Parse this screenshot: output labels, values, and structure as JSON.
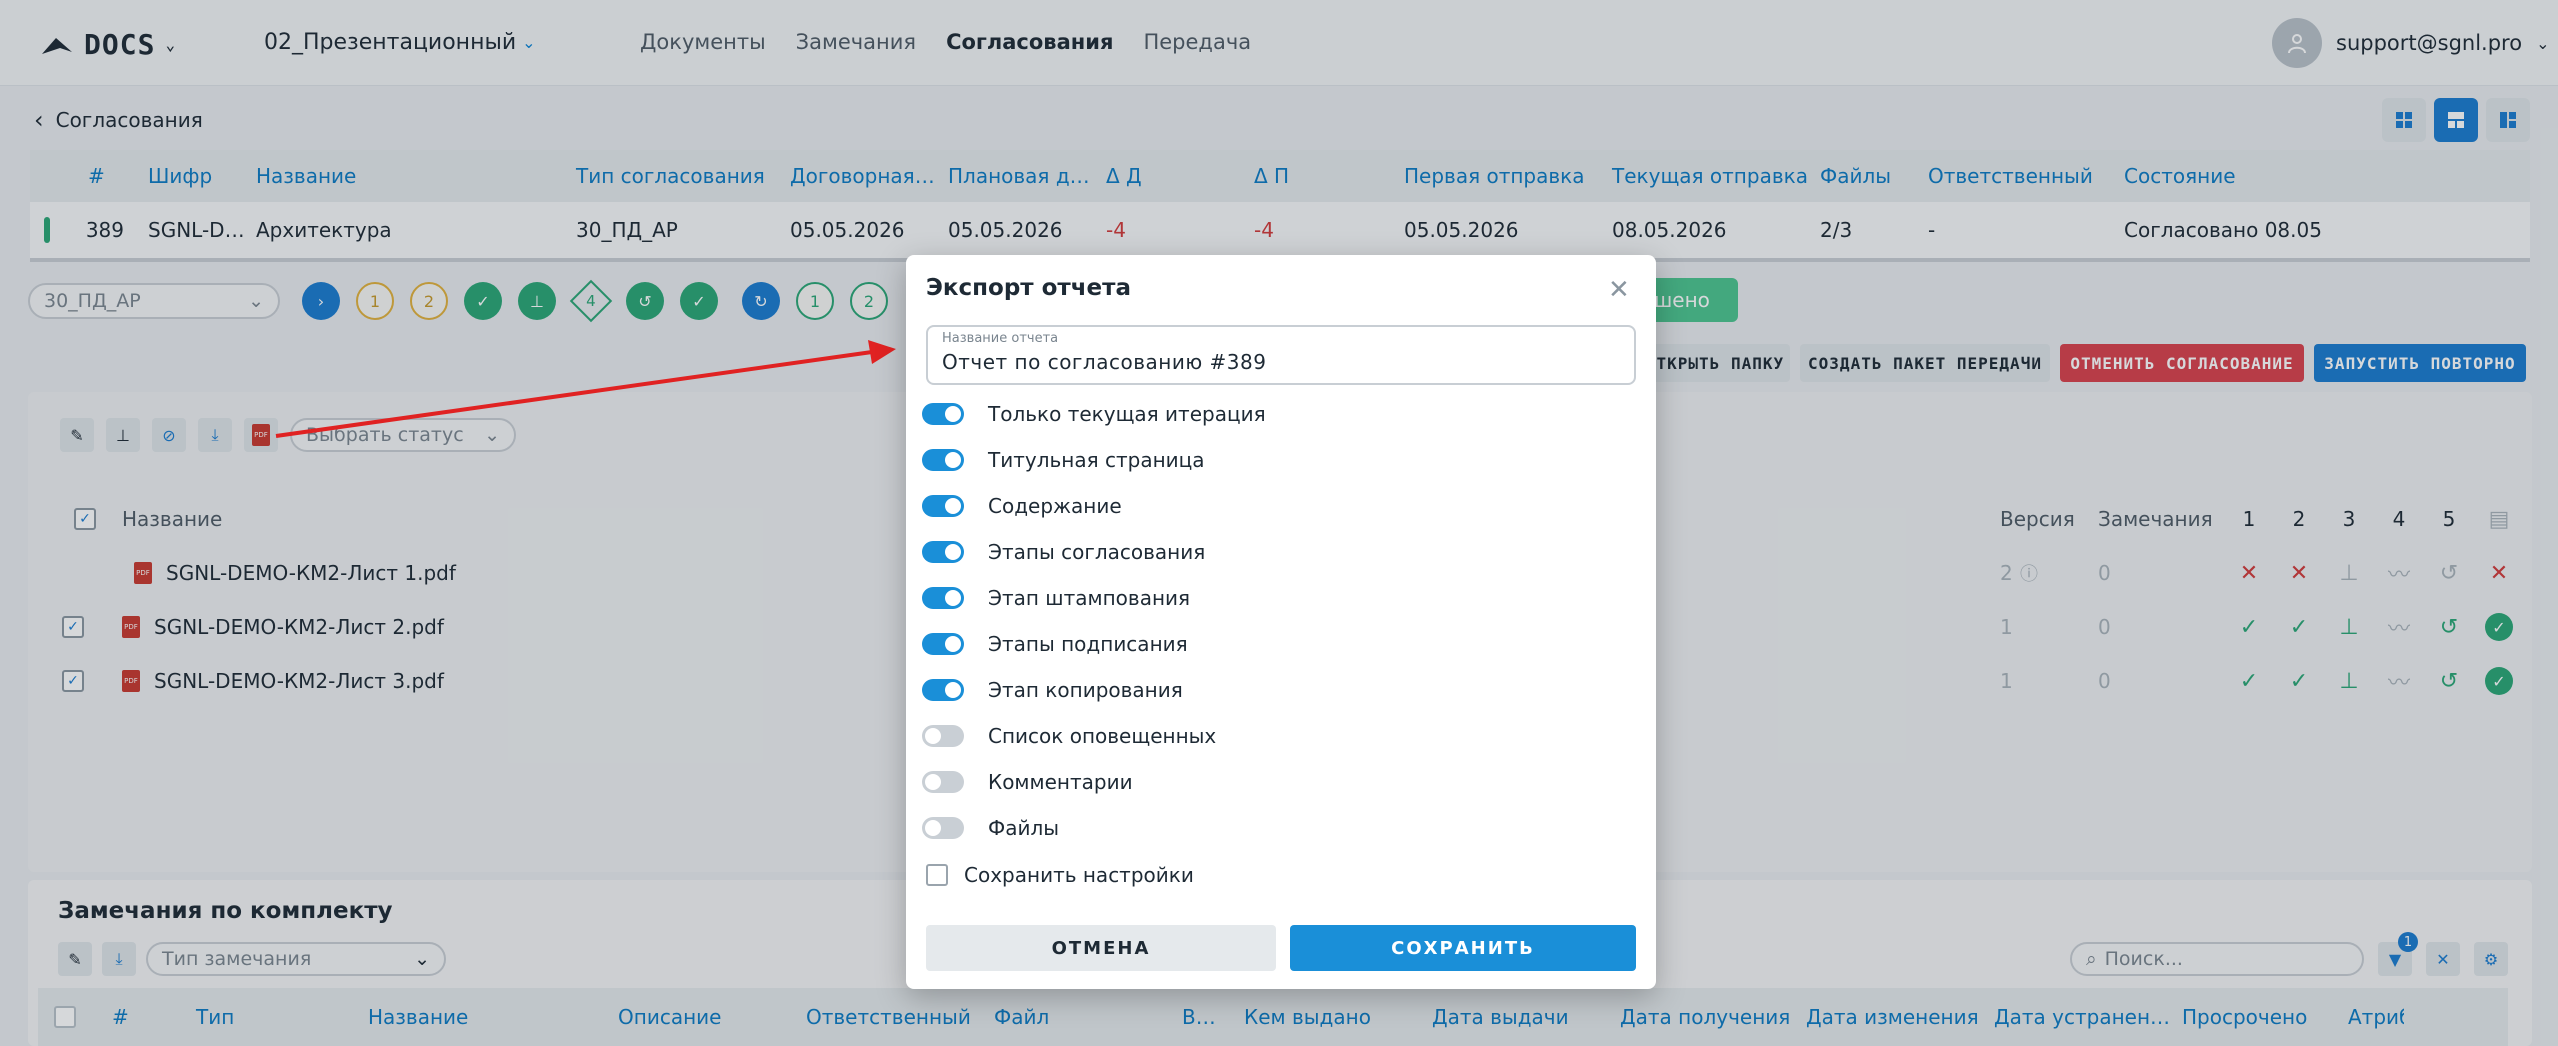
{
  "header": {
    "logo": "DOCS",
    "project": "02_Презентационный",
    "nav": [
      "Документы",
      "Замечания",
      "Согласования",
      "Передача"
    ],
    "user": "support@sgnl.pro"
  },
  "back": {
    "label": "Согласования"
  },
  "table": {
    "headers": [
      "#",
      "Шифр",
      "Название",
      "Тип согласования",
      "Договорная…",
      "Плановая д…",
      "Δ Д",
      "Δ П",
      "Первая отправка",
      "Текущая отправка",
      "Файлы",
      "Ответственный",
      "Состояние"
    ],
    "row": [
      "389",
      "SGNL-D…",
      "Архитектура",
      "30_ПД_АР",
      "05.05.2026",
      "05.05.2026",
      "-4",
      "-4",
      "05.05.2026",
      "08.05.2026",
      "2/3",
      "-",
      "Согласовано 08.05"
    ]
  },
  "flow": {
    "type_select": "30_ПД_АР",
    "steps_a": [
      "1",
      "2",
      "4"
    ],
    "steps_b": [
      "1",
      "2"
    ],
    "decided_label": "шено"
  },
  "actions": {
    "open_folder": "ОТКРЫТЬ ПАПКУ",
    "create_package": "СОЗДАТЬ ПАКЕТ ПЕРЕДАЧИ",
    "cancel_approval": "ОТМЕНИТЬ СОГЛАСОВАНИЕ",
    "restart": "ЗАПУСТИТЬ ПОВТОРНО"
  },
  "files": {
    "status_placeholder": "Выбрать статус",
    "col_name": "Название",
    "col_version": "Версия",
    "col_remarks": "Замечания",
    "stage_cols": [
      "1",
      "2",
      "3",
      "4",
      "5"
    ],
    "rows": [
      {
        "name": "SGNL-DEMO-КМ2-Лист 1.pdf",
        "version": "2",
        "remarks": "0"
      },
      {
        "name": "SGNL-DEMO-КМ2-Лист 2.pdf",
        "version": "1",
        "remarks": "0"
      },
      {
        "name": "SGNL-DEMO-КМ2-Лист 3.pdf",
        "version": "1",
        "remarks": "0"
      }
    ]
  },
  "remarks": {
    "title": "Замечания по комплекту",
    "type_placeholder": "Тип замечания",
    "search_placeholder": "Поиск...",
    "filter_badge": "1",
    "headers": [
      "#",
      "Тип",
      "Название",
      "Описание",
      "Ответственный",
      "Файл",
      "В…",
      "Кем выдано",
      "Дата выдачи",
      "Дата получения",
      "Дата изменения",
      "Дата устранен…",
      "Просрочено",
      "Атрибу"
    ]
  },
  "modal": {
    "title": "Экспорт отчета",
    "name_label": "Название отчета",
    "name_value": "Отчет по согласованию #389",
    "options": [
      {
        "label": "Только текущая итерация",
        "on": true
      },
      {
        "label": "Титульная страница",
        "on": true
      },
      {
        "label": "Содержание",
        "on": true
      },
      {
        "label": "Этапы согласования",
        "on": true
      },
      {
        "label": "Этап штампования",
        "on": true
      },
      {
        "label": "Этапы подписания",
        "on": true
      },
      {
        "label": "Этап копирования",
        "on": true
      },
      {
        "label": "Список оповещенных",
        "on": false
      },
      {
        "label": "Комментарии",
        "on": false
      },
      {
        "label": "Файлы",
        "on": false
      }
    ],
    "save_settings": "Сохранить настройки",
    "cancel": "ОТМЕНА",
    "save": "СОХРАНИТЬ"
  },
  "colors": {
    "accent": "#1a8fd8",
    "success": "#2aa776",
    "danger": "#d23a3a",
    "warning": "#e2b13c"
  }
}
